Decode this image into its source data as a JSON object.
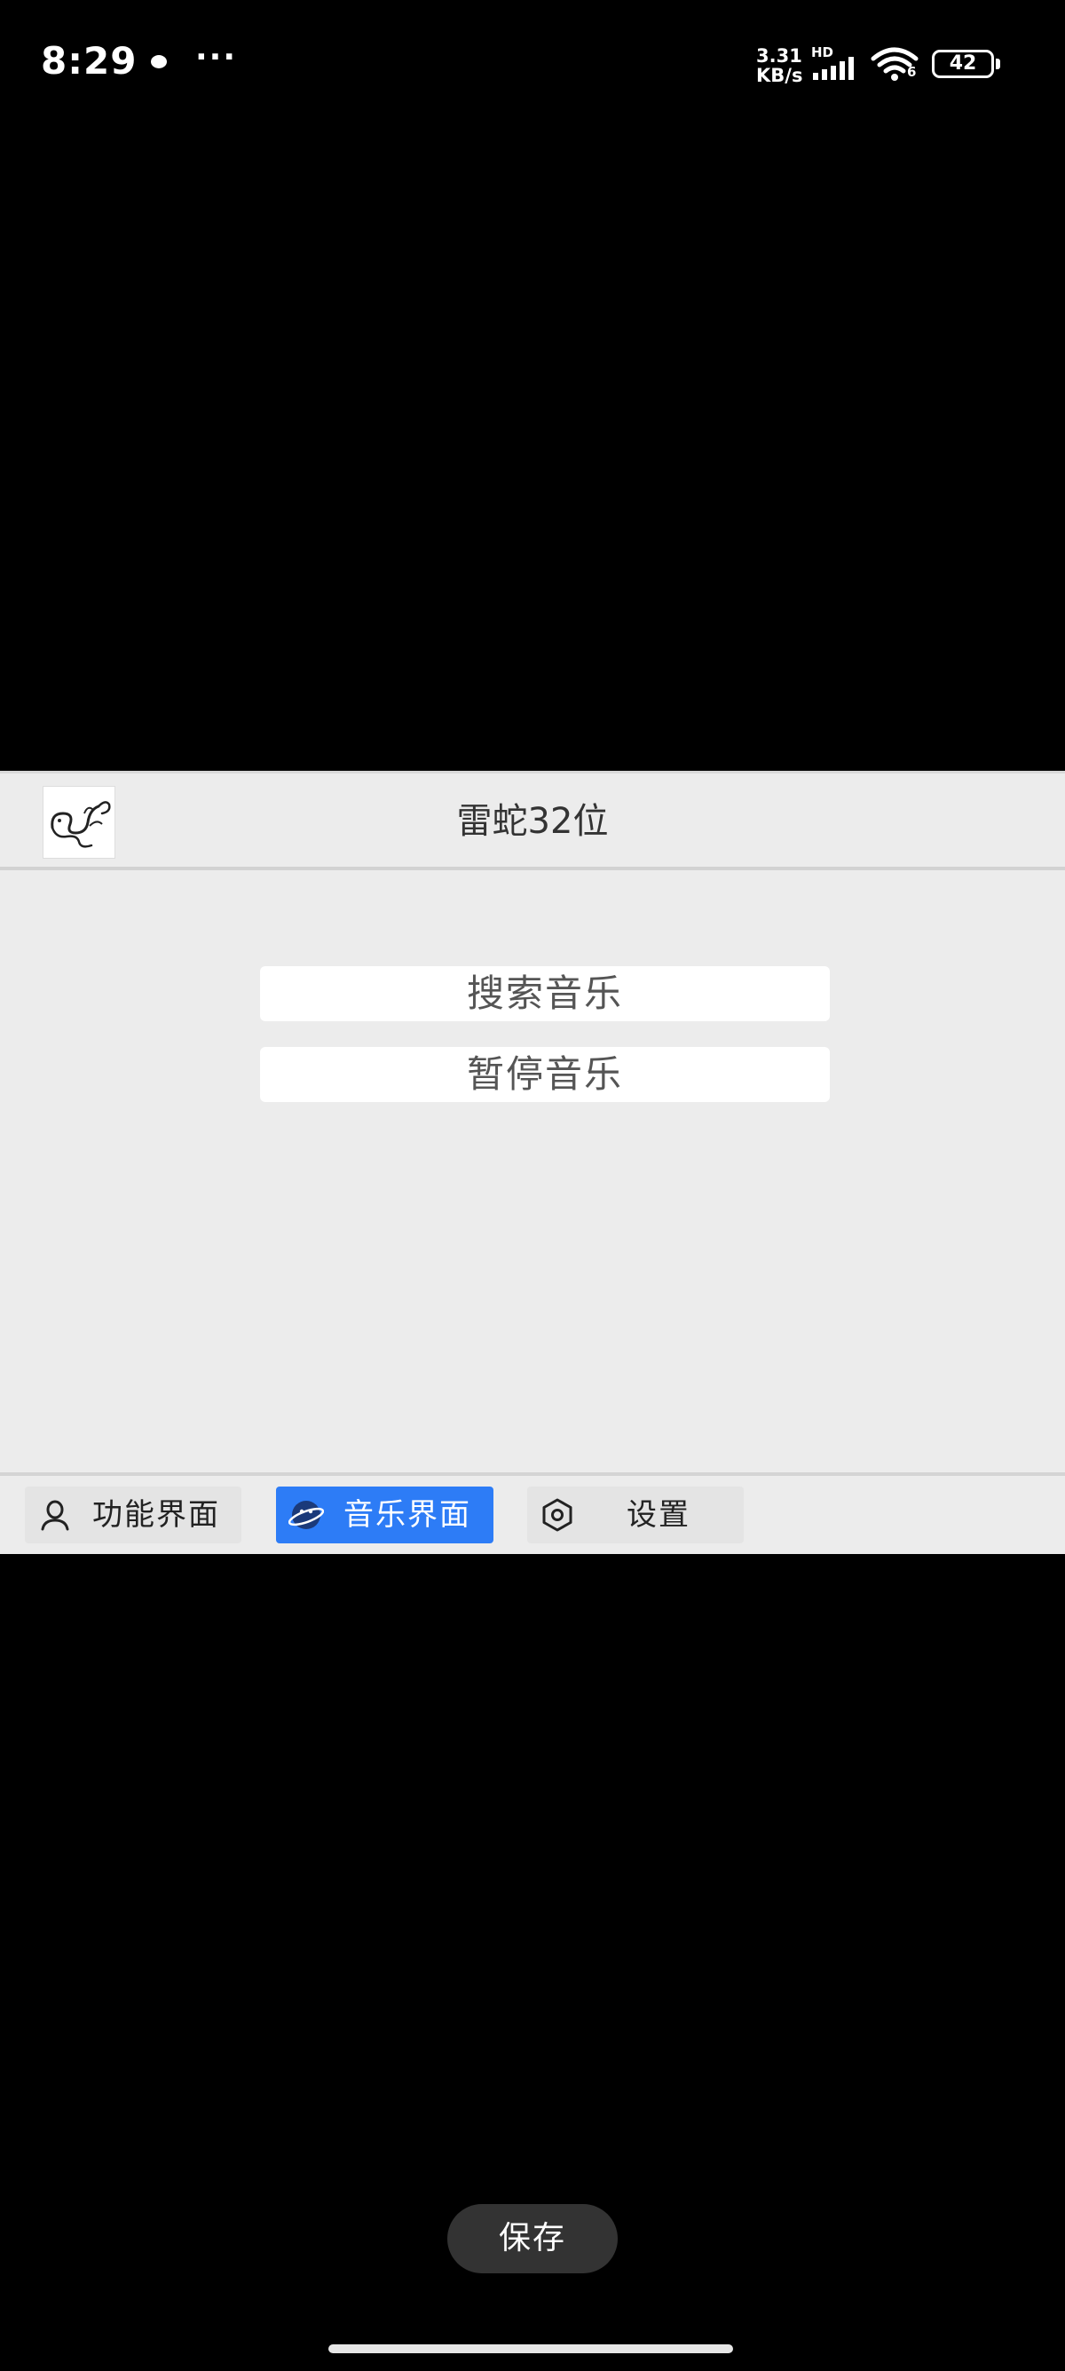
{
  "status_bar": {
    "time": "8:29",
    "more": "···",
    "speed": "3.31 KB/s",
    "hd": "HD",
    "wifi_badge": "6",
    "battery": "42"
  },
  "app": {
    "title": "雷蛇32位",
    "logo_icon": "snake-logo-icon",
    "buttons": {
      "search_music": "搜索音乐",
      "pause_music": "暂停音乐"
    },
    "tabs": [
      {
        "label": "功能界面",
        "icon": "user-icon",
        "active": false
      },
      {
        "label": "音乐界面",
        "icon": "planet-face-icon",
        "active": true
      },
      {
        "label": "设置",
        "icon": "hexagon-settings-icon",
        "active": false
      }
    ],
    "accent_color": "#2d7cf6"
  },
  "save_label": "保存"
}
